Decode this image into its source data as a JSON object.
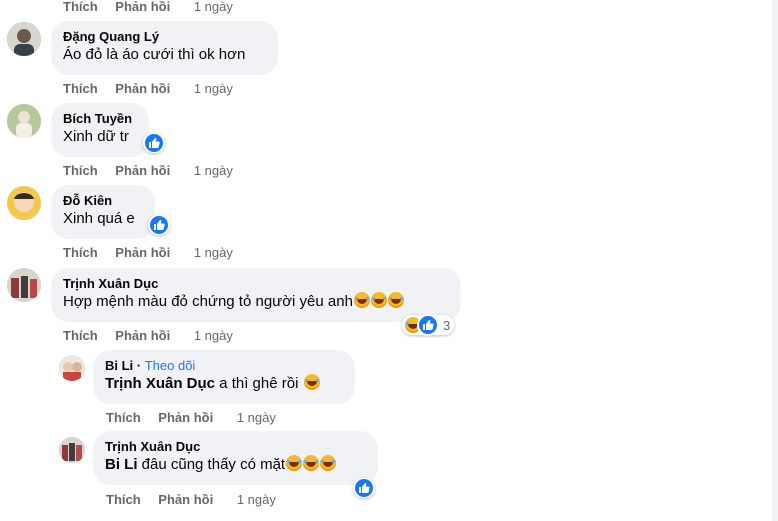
{
  "top_actions": {
    "like": "Thích",
    "reply": "Phản hồi",
    "time": "1 ngày"
  },
  "comments": [
    {
      "name": "Đặng Quang Lý",
      "text": "Áo đỏ là áo cưới thì ok hơn",
      "like": "Thích",
      "reply": "Phản hồi",
      "time": "1 ngày"
    },
    {
      "name": "Bích Tuyền",
      "text": "Xinh dữ tr",
      "like": "Thích",
      "reply": "Phản hồi",
      "time": "1 ngày"
    },
    {
      "name": "Đỗ Kiên",
      "text": "Xinh quá e",
      "like": "Thích",
      "reply": "Phản hồi",
      "time": "1 ngày"
    },
    {
      "name": "Trịnh Xuân Dục",
      "text": "Hợp mệnh màu đỏ chứng tỏ người yêu anh",
      "like": "Thích",
      "reply": "Phản hồi",
      "time": "1 ngày",
      "reaction_count": "3"
    }
  ],
  "replies": [
    {
      "name": "Bi Li",
      "follow": "Theo dõi",
      "mention": "Trịnh Xuân Dục",
      "text": " a thì ghê rồi",
      "like": "Thích",
      "reply": "Phản hồi",
      "time": "1 ngày"
    },
    {
      "name": "Trịnh Xuân Dục",
      "mention": "Bi Li",
      "text": " đâu cũng thấy có mặt",
      "like": "Thích",
      "reply": "Phản hồi",
      "time": "1 ngày"
    }
  ],
  "colors": {
    "bubble": "#f0f2f5",
    "link": "#1877f2",
    "meta": "#65676b",
    "laugh": "#f7b928"
  },
  "icons": {
    "like": "like-icon",
    "laugh": "laugh-emoji"
  }
}
